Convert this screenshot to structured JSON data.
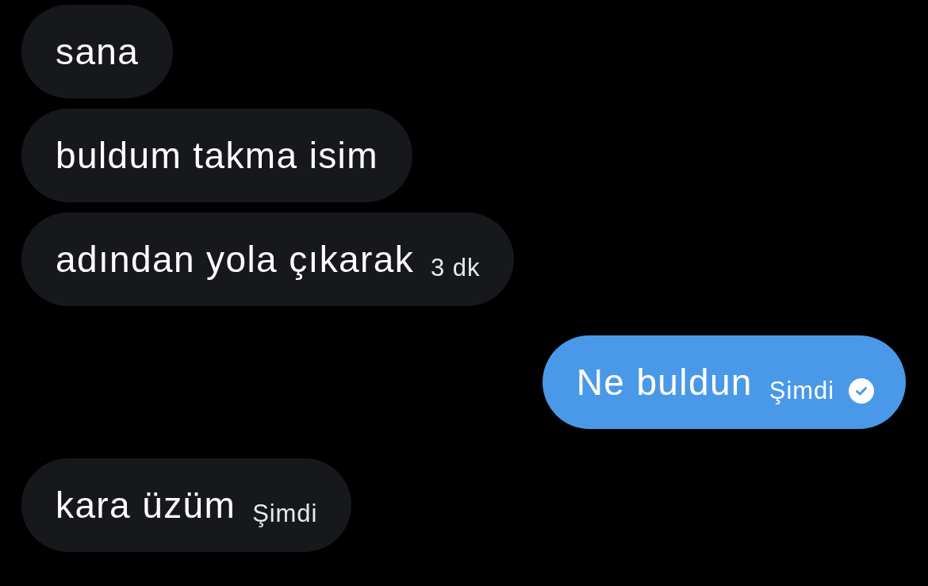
{
  "messages": [
    {
      "kind": "incoming",
      "text": "sana"
    },
    {
      "kind": "incoming",
      "text": "buldum takma isim"
    },
    {
      "kind": "incoming",
      "text": "adından yola çıkarak",
      "time": "3 dk"
    },
    {
      "kind": "outgoing",
      "text": "Ne buldun",
      "time": "Şimdi",
      "delivered": true
    },
    {
      "kind": "incoming",
      "text": "kara üzüm",
      "time": "Şimdi"
    }
  ]
}
